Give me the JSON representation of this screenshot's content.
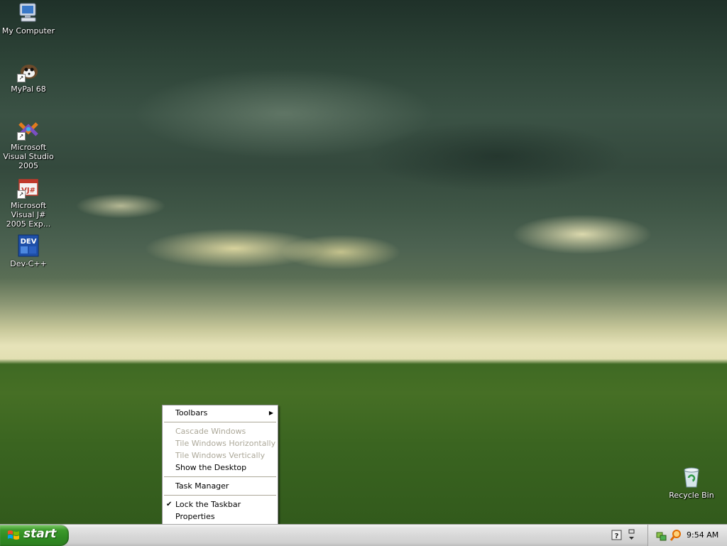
{
  "desktop": {
    "icons": [
      {
        "label": "My Computer",
        "icon": "computer-icon"
      },
      {
        "label": "MyPal 68",
        "icon": "mypal-icon"
      },
      {
        "label": "Microsoft Visual Studio 2005",
        "icon": "visual-studio-icon"
      },
      {
        "label": "Microsoft Visual J# 2005 Exp...",
        "icon": "vjsharp-icon",
        "badge": "VJ#"
      },
      {
        "label": "Dev-C++",
        "icon": "devcpp-icon",
        "badge": "DEV"
      },
      {
        "label": "Recycle Bin",
        "icon": "recycle-bin-icon"
      }
    ]
  },
  "context_menu": {
    "items": [
      {
        "label": "Toolbars",
        "enabled": true,
        "submenu": true
      },
      {
        "label": "Cascade Windows",
        "enabled": false
      },
      {
        "label": "Tile Windows Horizontally",
        "enabled": false
      },
      {
        "label": "Tile Windows Vertically",
        "enabled": false
      },
      {
        "label": "Show the Desktop",
        "enabled": true
      },
      {
        "label": "Task Manager",
        "enabled": true
      },
      {
        "label": "Lock the Taskbar",
        "enabled": true,
        "checked": true
      },
      {
        "label": "Properties",
        "enabled": true
      }
    ],
    "check_glyph": "✔",
    "submenu_glyph": "▶"
  },
  "taskbar": {
    "start_label": "start",
    "clock": "9:54 AM"
  },
  "colors": {
    "start_green": "#3c9a2b",
    "menu_disabled": "#aca899"
  }
}
